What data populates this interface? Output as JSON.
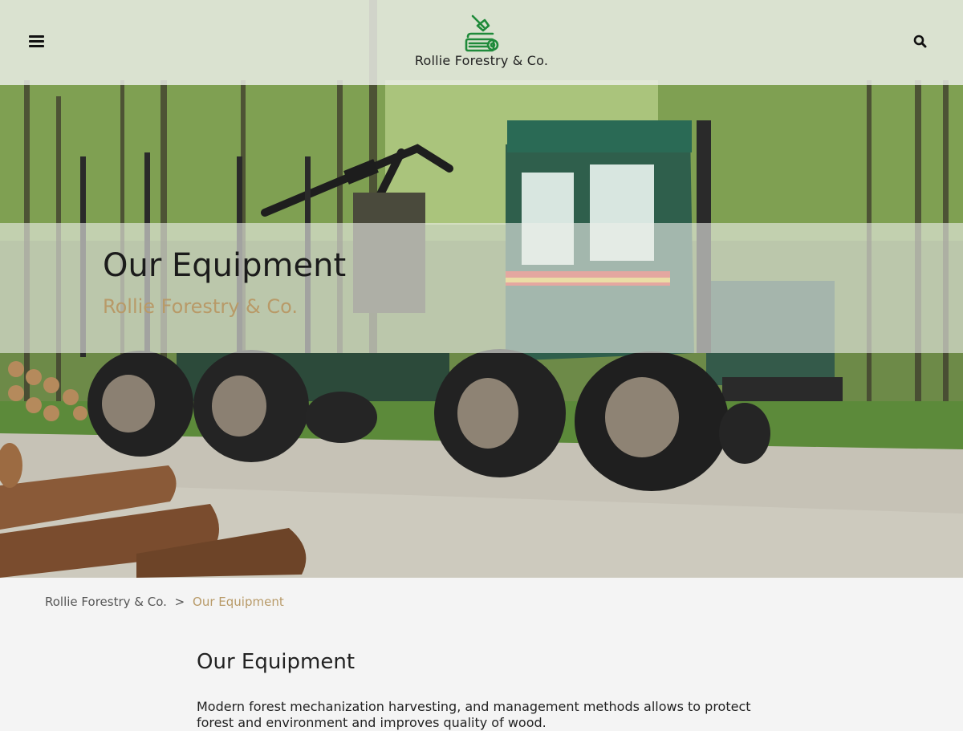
{
  "header": {
    "menu_icon": "hamburger-menu-icon",
    "logo_icon": "log-saw-icon",
    "logo_text": "Rollie Forestry & Co.",
    "search_icon": "search-icon",
    "brand_green": "#1f8a3a"
  },
  "hero": {
    "title": "Our Equipment",
    "subtitle": "Rollie Forestry & Co.",
    "subtitle_color": "#b89a68"
  },
  "breadcrumb": {
    "home": "Rollie Forestry & Co.",
    "separator": ">",
    "current": "Our Equipment"
  },
  "content": {
    "title": "Our Equipment",
    "paragraph": "Modern forest mechanization harvesting, and management methods allows to protect forest and environment and improves quality of wood."
  }
}
